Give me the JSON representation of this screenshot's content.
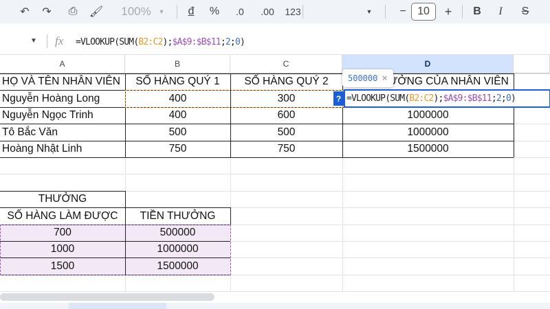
{
  "toolbar": {
    "zoom": "100%",
    "currency": "đ",
    "percent": "%",
    "dec_less": ".0",
    "dec_more": ".00",
    "format_123": "123",
    "font_size": "10",
    "minus": "−",
    "plus": "+",
    "bold": "B",
    "italic": "I",
    "strike": "S"
  },
  "formula_bar": {
    "fx": "fx",
    "parts": [
      [
        "=VLOOKUP(SUM(",
        ""
      ],
      [
        "B2:C2",
        "o"
      ],
      [
        ");",
        ""
      ],
      [
        "$A$9:$B$11",
        "p"
      ],
      [
        ";",
        ""
      ],
      [
        "2",
        "b"
      ],
      [
        ";",
        ""
      ],
      [
        "0",
        "b"
      ],
      [
        ")",
        ""
      ]
    ]
  },
  "columns": [
    "A",
    "B",
    "C",
    "D"
  ],
  "selected_column": "D",
  "table1": {
    "headers": [
      "HỌ VÀ TÊN NHÂN VIÊN",
      "SỐ HÀNG QUÝ 1",
      "SỐ HÀNG QUÝ 2",
      "TIỀN THƯỞNG CỦA NHÂN VIÊN"
    ],
    "rows": [
      [
        "Nguyễn Hoàng Long",
        "400",
        "300",
        ""
      ],
      [
        "Nguyễn Ngọc Trinh",
        "400",
        "600",
        "1000000"
      ],
      [
        "Tô Bắc Văn",
        "500",
        "500",
        "1000000"
      ],
      [
        "Hoàng Nhật Linh",
        "750",
        "750",
        "1500000"
      ]
    ]
  },
  "table2": {
    "title": "THƯỞNG",
    "headers": [
      "SỐ HÀNG LÀM ĐƯỢC",
      "TIỀN THƯỞNG"
    ],
    "rows": [
      [
        "700",
        "500000"
      ],
      [
        "1000",
        "1000000"
      ],
      [
        "1500",
        "1500000"
      ]
    ]
  },
  "tooltip": {
    "value": "500000",
    "close": "×",
    "help": "?"
  },
  "colors": {
    "ref_orange": "#e69a2e",
    "ref_purple": "#9c4fb8",
    "selection_blue": "#1a5fd6",
    "lookup_fill": "#f3e9f6"
  }
}
